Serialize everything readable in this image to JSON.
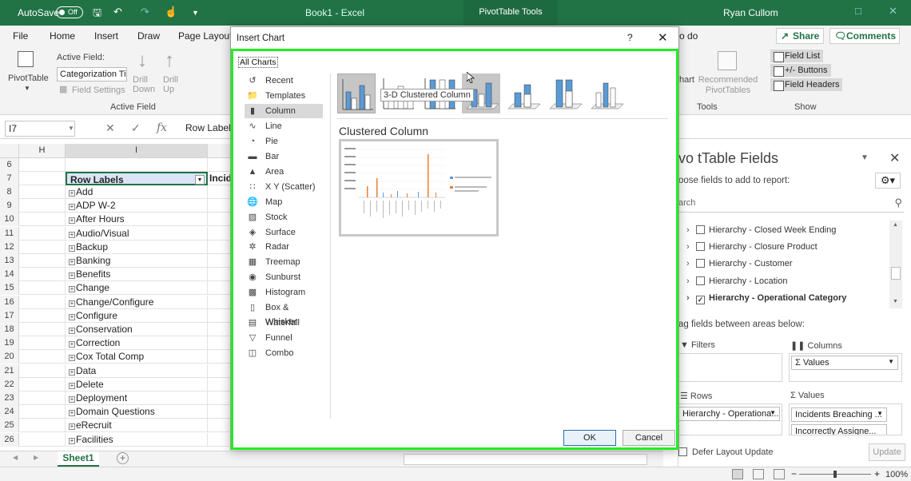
{
  "titlebar": {
    "autosave_label": "AutoSave",
    "autosave_state": "Off",
    "document_title": "Book1 - Excel",
    "contextual_tab": "PivotTable Tools",
    "user": "Ryan Cullom"
  },
  "ribbon": {
    "tabs": [
      "File",
      "Home",
      "Insert",
      "Draw",
      "Page Layout"
    ],
    "tell_me_suffix": "o do",
    "share": "Share",
    "comments": "Comments",
    "pivottable_label": "PivotTable",
    "active_field_label": "Active Field:",
    "active_field_value": "Categorization Tie",
    "field_settings": "Field Settings",
    "drill_down": "Drill Down",
    "drill_up": "Drill Up",
    "active_field_group": "Active Field",
    "chart_partial": "hart",
    "recommended_pivottables": "Recommended PivotTables",
    "tools_group": "Tools",
    "field_list": "Field List",
    "buttons": "+/- Buttons",
    "field_headers": "Field Headers",
    "show_group": "Show"
  },
  "formula_bar": {
    "name_box": "I7",
    "content": "Row Label"
  },
  "grid": {
    "columns": [
      "H",
      "I"
    ],
    "header_row_num": "7",
    "header_label": "Row Labels",
    "header_next_col": "Incid",
    "empty_row_num": "6",
    "rows": [
      {
        "num": "8",
        "label": "Add"
      },
      {
        "num": "9",
        "label": "ADP W-2"
      },
      {
        "num": "10",
        "label": "After Hours"
      },
      {
        "num": "11",
        "label": "Audio/Visual"
      },
      {
        "num": "12",
        "label": "Backup"
      },
      {
        "num": "13",
        "label": "Banking"
      },
      {
        "num": "14",
        "label": "Benefits"
      },
      {
        "num": "15",
        "label": "Change"
      },
      {
        "num": "16",
        "label": "Change/Configure"
      },
      {
        "num": "17",
        "label": "Configure"
      },
      {
        "num": "18",
        "label": "Conservation"
      },
      {
        "num": "19",
        "label": "Correction"
      },
      {
        "num": "20",
        "label": "Cox Total Comp"
      },
      {
        "num": "21",
        "label": "Data"
      },
      {
        "num": "22",
        "label": "Delete"
      },
      {
        "num": "23",
        "label": "Deployment"
      },
      {
        "num": "24",
        "label": "Domain Questions"
      },
      {
        "num": "25",
        "label": "eRecruit"
      },
      {
        "num": "26",
        "label": "Facilities"
      }
    ]
  },
  "sheet": {
    "tab_name": "Sheet1",
    "zoom": "100%"
  },
  "pivot_pane": {
    "title": "vo tTable Fields",
    "subtitle": "oose fields to add to report:",
    "search_placeholder": "arch",
    "fields": [
      {
        "label": "Hierarchy - Closed Week Ending",
        "checked": false
      },
      {
        "label": "Hierarchy - Closure Product",
        "checked": false
      },
      {
        "label": "Hierarchy - Customer",
        "checked": false
      },
      {
        "label": "Hierarchy - Location",
        "checked": false
      },
      {
        "label": "Hierarchy - Operational Category",
        "checked": true
      }
    ],
    "drag_label": "ag fields between areas below:",
    "filters": "Filters",
    "columns": "Columns",
    "columns_value": "Values",
    "rows": "Rows",
    "rows_value": "Hierarchy - Operationa...",
    "values": "Values",
    "values_items": [
      "Incidents Breaching ...",
      "Incorrectly Assigne..."
    ],
    "defer": "Defer Layout Update",
    "update": "Update"
  },
  "dialog": {
    "title": "Insert Chart",
    "help": "?",
    "tab": "All Charts",
    "chart_types": [
      "Recent",
      "Templates",
      "Column",
      "Line",
      "Pie",
      "Bar",
      "Area",
      "X Y (Scatter)",
      "Map",
      "Stock",
      "Surface",
      "Radar",
      "Treemap",
      "Sunburst",
      "Histogram",
      "Box & Whisker",
      "Waterfall",
      "Funnel",
      "Combo"
    ],
    "selected_type": "Column",
    "tooltip": "3-D Clustered Column",
    "subtype_title": "Clustered Column",
    "ok": "OK",
    "cancel": "Cancel"
  },
  "colors": {
    "excel_green": "#217346",
    "highlight_frame": "#22ee22",
    "bar_blue": "#5b9bd5",
    "bar_orange": "#ed7d31"
  }
}
